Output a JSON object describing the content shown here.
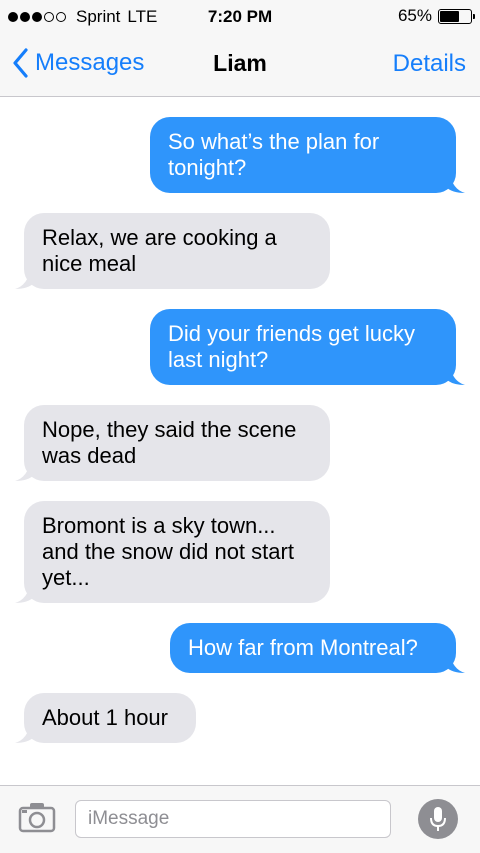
{
  "status_bar": {
    "carrier": "Sprint",
    "network": "LTE",
    "time": "7:20 PM",
    "battery": "65%",
    "battery_level": 0.65,
    "signal_full": 3,
    "signal_total": 5
  },
  "nav": {
    "back_label": "Messages",
    "title": "Liam",
    "details_label": "Details"
  },
  "messages": [
    {
      "direction": "sent",
      "text": "So what’s the plan for tonight?"
    },
    {
      "direction": "received",
      "text": "Relax, we are cooking a nice meal"
    },
    {
      "direction": "sent",
      "text": "Did your friends get lucky last night?"
    },
    {
      "direction": "received",
      "text": "Nope, they said the scene was dead"
    },
    {
      "direction": "received",
      "text": "Bromont is a sky town... and the snow did not start yet..."
    },
    {
      "direction": "sent",
      "text": "How far from Montreal?"
    },
    {
      "direction": "received",
      "text": "About 1 hour"
    }
  ],
  "input": {
    "placeholder": "iMessage",
    "value": ""
  },
  "colors": {
    "accent": "#157efb",
    "sent_bubble": "#2f95fb",
    "received_bubble": "#e5e5ea"
  },
  "icons": {
    "back": "chevron-left-icon",
    "camera": "camera-icon",
    "mic": "microphone-icon"
  }
}
